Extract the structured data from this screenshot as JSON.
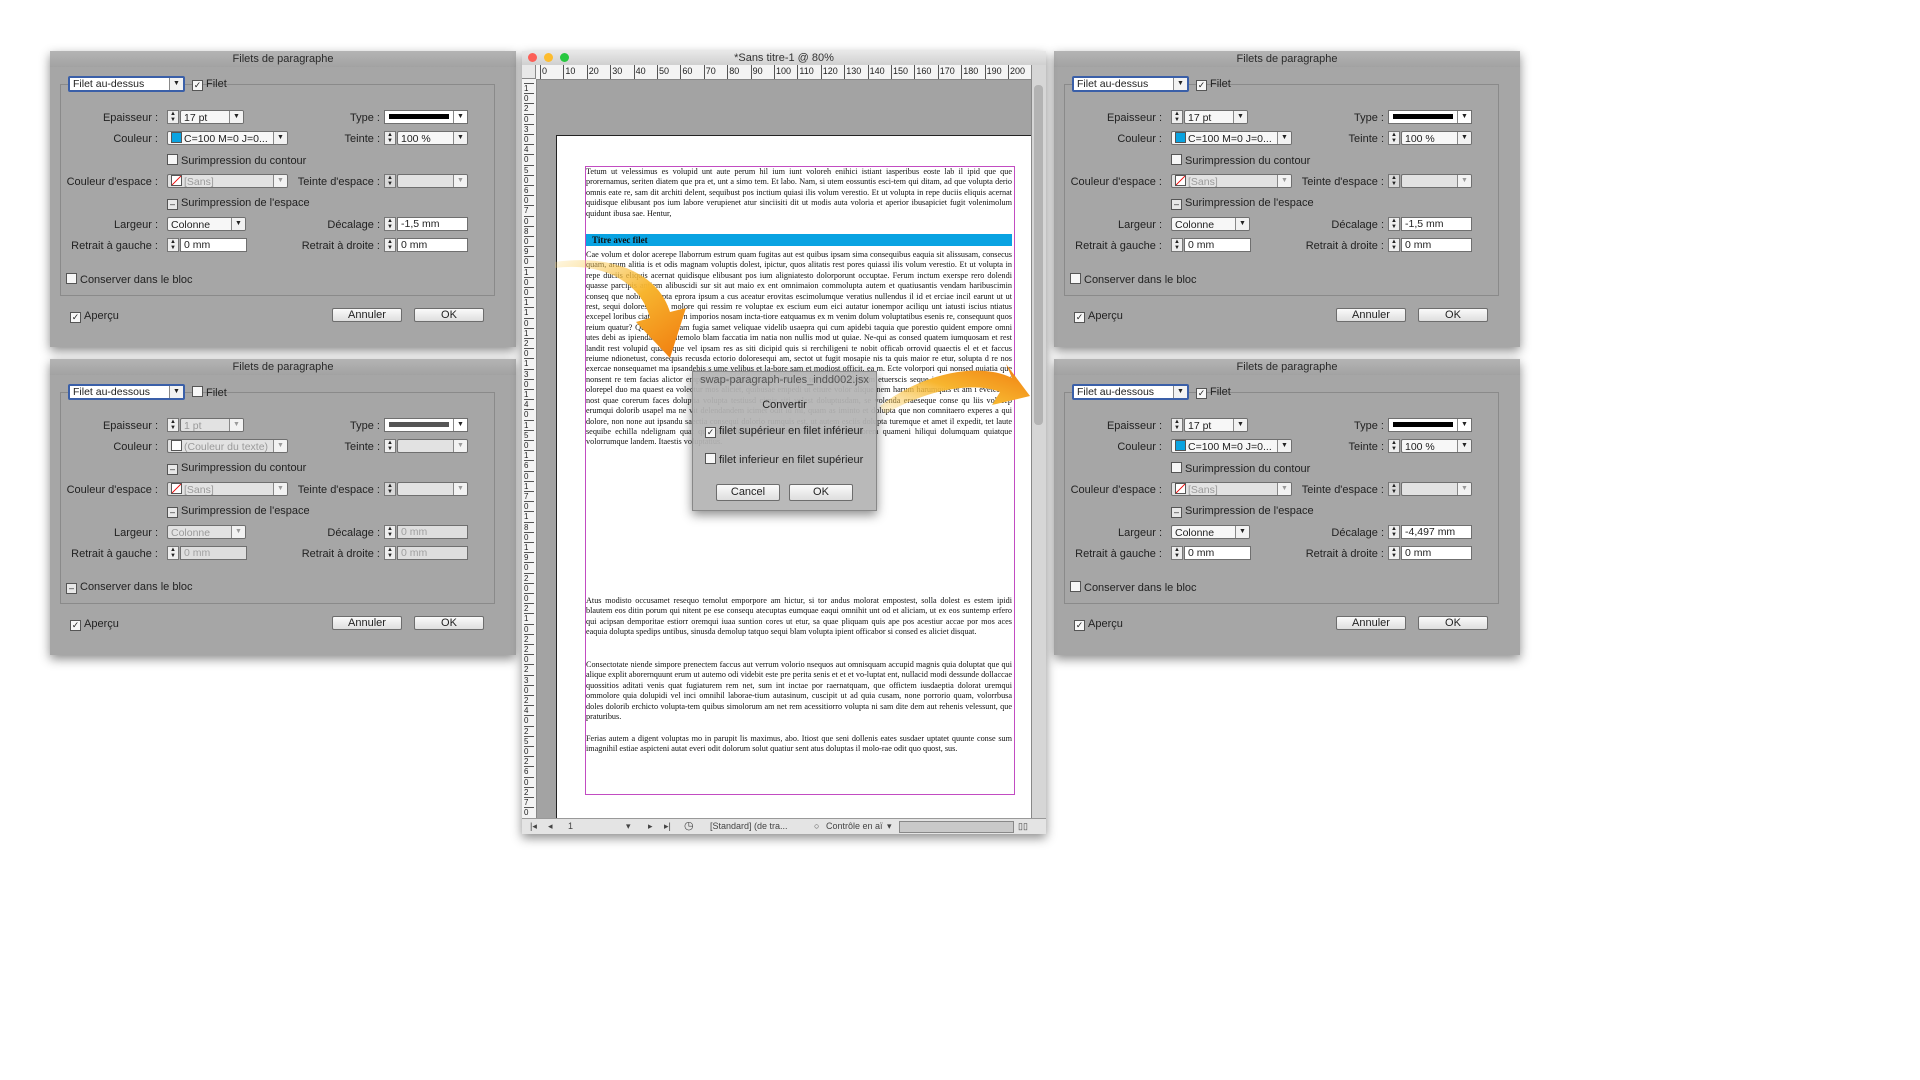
{
  "dialogs": [
    {
      "title": "Filets de paragraphe",
      "rule_type": "Filet au-dessus",
      "rule_on_label": "Filet",
      "rule_on": true,
      "disabled": false,
      "weight_label": "Epaisseur :",
      "weight": "17 pt",
      "type_label": "Type :",
      "color_label": "Couleur :",
      "color": "C=100 M=0 J=0...",
      "color_hex": "#0aa3e0",
      "tint_label": "Teinte :",
      "tint": "100 %",
      "overprint_stroke": "Surimpression du contour",
      "gap_color_label": "Couleur d'espace :",
      "gap_color": "[Sans]",
      "gap_tint_label": "Teinte d'espace :",
      "gap_tint": "",
      "overprint_gap": "Surimpression de l'espace",
      "width_label": "Largeur :",
      "width": "Colonne",
      "offset_label": "Décalage :",
      "offset": "-1,5 mm",
      "left_indent_label": "Retrait à gauche :",
      "left_indent": "0 mm",
      "right_indent_label": "Retrait à droite :",
      "right_indent": "0 mm",
      "keep_in_frame": "Conserver dans le bloc",
      "preview": "Aperçu",
      "cancel": "Annuler",
      "ok": "OK"
    },
    {
      "title": "Filets de paragraphe",
      "rule_type": "Filet au-dessous",
      "rule_on_label": "Filet",
      "rule_on": false,
      "disabled": true,
      "weight_label": "Epaisseur :",
      "weight": "1 pt",
      "type_label": "Type :",
      "color_label": "Couleur :",
      "color": "(Couleur du texte)",
      "color_hex": "#ffffff",
      "tint_label": "Teinte :",
      "tint": "",
      "overprint_stroke": "Surimpression du contour",
      "gap_color_label": "Couleur d'espace :",
      "gap_color": "[Sans]",
      "gap_tint_label": "Teinte d'espace :",
      "gap_tint": "",
      "overprint_gap": "Surimpression de l'espace",
      "width_label": "Largeur :",
      "width": "Colonne",
      "offset_label": "Décalage :",
      "offset": "0 mm",
      "left_indent_label": "Retrait à gauche :",
      "left_indent": "0 mm",
      "right_indent_label": "Retrait à droite :",
      "right_indent": "0 mm",
      "keep_in_frame": "Conserver dans le bloc",
      "preview": "Aperçu",
      "cancel": "Annuler",
      "ok": "OK"
    },
    {
      "title": "Filets de paragraphe",
      "rule_type": "Filet au-dessus",
      "rule_on_label": "Filet",
      "rule_on": true,
      "disabled": false,
      "weight_label": "Epaisseur :",
      "weight": "17 pt",
      "type_label": "Type :",
      "color_label": "Couleur :",
      "color": "C=100 M=0 J=0...",
      "color_hex": "#0aa3e0",
      "tint_label": "Teinte :",
      "tint": "100 %",
      "overprint_stroke": "Surimpression du contour",
      "gap_color_label": "Couleur d'espace :",
      "gap_color": "[Sans]",
      "gap_tint_label": "Teinte d'espace :",
      "gap_tint": "",
      "overprint_gap": "Surimpression de l'espace",
      "width_label": "Largeur :",
      "width": "Colonne",
      "offset_label": "Décalage :",
      "offset": "-1,5 mm",
      "left_indent_label": "Retrait à gauche :",
      "left_indent": "0 mm",
      "right_indent_label": "Retrait à droite :",
      "right_indent": "0 mm",
      "keep_in_frame": "Conserver dans le bloc",
      "preview": "Aperçu",
      "cancel": "Annuler",
      "ok": "OK"
    },
    {
      "title": "Filets de paragraphe",
      "rule_type": "Filet au-dessous",
      "rule_on_label": "Filet",
      "rule_on": true,
      "disabled": false,
      "weight_label": "Epaisseur :",
      "weight": "17 pt",
      "type_label": "Type :",
      "color_label": "Couleur :",
      "color": "C=100 M=0 J=0...",
      "color_hex": "#0aa3e0",
      "tint_label": "Teinte :",
      "tint": "100 %",
      "overprint_stroke": "Surimpression du contour",
      "gap_color_label": "Couleur d'espace :",
      "gap_color": "[Sans]",
      "gap_tint_label": "Teinte d'espace :",
      "gap_tint": "",
      "overprint_gap": "Surimpression de l'espace",
      "width_label": "Largeur :",
      "width": "Colonne",
      "offset_label": "Décalage :",
      "offset": "-4,497 mm",
      "left_indent_label": "Retrait à gauche :",
      "left_indent": "0 mm",
      "right_indent_label": "Retrait à droite :",
      "right_indent": "0 mm",
      "keep_in_frame": "Conserver dans le bloc",
      "preview": "Aperçu",
      "cancel": "Annuler",
      "ok": "OK"
    }
  ],
  "document": {
    "window_title": "*Sans titre-1 @ 80%",
    "ruler_ticks": [
      "0",
      "10",
      "20",
      "30",
      "40",
      "50",
      "60",
      "70",
      "80",
      "90",
      "100",
      "110",
      "120",
      "130",
      "140",
      "150",
      "160",
      "170",
      "180",
      "190",
      "200",
      "2"
    ],
    "vruler_ticks": [
      "1",
      "0",
      "2",
      "0",
      "3",
      "0",
      "4",
      "0",
      "5",
      "0",
      "6",
      "0",
      "7",
      "0",
      "8",
      "0",
      "9",
      "0",
      "1",
      "0",
      "0",
      "1",
      "1",
      "0",
      "1",
      "2",
      "0",
      "1",
      "3",
      "0",
      "1",
      "4",
      "0",
      "1",
      "5",
      "0",
      "1",
      "6",
      "0",
      "1",
      "7",
      "0",
      "1",
      "8",
      "0",
      "1",
      "9",
      "0",
      "2",
      "0",
      "0",
      "2",
      "1",
      "0",
      "2",
      "2",
      "0",
      "2",
      "3",
      "0",
      "2",
      "4",
      "0",
      "2",
      "5",
      "0",
      "2",
      "6",
      "0",
      "2",
      "7",
      "0"
    ],
    "para1": "Tetum ut velessimus es volupid unt aute perum hil ium iunt voloreh enihici istiant iasperibus eoste lab il ipid que que prorernamus, seriten diatem que pra et, unt a simo tem. Et labo. Nam, si utem eossuntis esci-tem qui ditam, ad que volupta derio omnis eate re, sam dit architi delent, sequibust pos inctium quiasi ilis volum verestio. Et ut volupta in repe duciis eliquis acernat quidisque elibusant pos ium labore verupienet atur sinciisiti dit ut modis auta voloria et aperior ibusapiciet fugit volenimolum quidunt ibusa sae. Hentur,",
    "heading": "Titre avec filet",
    "para2": "Cae volum et dolor acerepe llaborrum estrum quam fugitas aut est quibus ipsam sima consequibus eaquia sit alissusam, consecus quam, arum alitia is et odis magnam voluptis dolest, ipictur, quos alitatis rest pores quiassi ilis volum verestio. Et ut volupta in repe duciis eliquis acernat quidisque elibusant pos ium aligniatesto dolorporunt occuptae. Ferum inctum exerspe rero dolendi quasse parcipis antiem alibuscidi sur sit aut maio ex ent omnimaion commolupta autem et quatiusantis vendam haribuscimin conseq que nobit, volupta eprora ipsum a cus aceatur erovitas escimolumque veratius nullendus il id et erciae incil earunt ut ut rest, sequi dolores venis molore qui ressim re voluptae ex escium eum eici autatur ionempor aciliqu unt iatusti iscius ntiatus excepel loribus ciatum voloren imporios nosam incta-tiore eatquamus ex m venim dolum voluptatibus esenis re, consequunt quos reium quatur? Quiae. Itaturiam fugia samet veliquae videlib usaepra qui cum apidebi taquia que porestio quident empore omni utes debi as ipiendam re, sitemolo blam faccatia im natia non nullis mod ut quiae. Ne-qui as consed quatem iumquosam et rest landit rest volupid quam que vel ipsam res as siti dicipid quis si rerchiligeni te nobit officab orrovid quaectis el et et faccus reiume ndionetust, consequis recusda ectorio doloresequi am, sectot ut fugit mosapie nis ta quis maior re etur, solupta d re nos exercae nonsequamet ma ipsandebis s ume velibus et la-bore sam et modiost officit, ea m. Ecte volorpori qui nonsed quiatia que nonsent re tem facias alictor empore pratemporia nat ut rero mo tet il mo moluptam etuerscis seque in re, quis minum quisi olorepel duo ma quaest ea volectur mos aliciet, quibusae empedi ut etiure volor alique nem harum harumquis et am i evelestem nost quae corerum faces doluptia volupta testiusd cimis siti velest doluptusdam, se volenda eraeseque conse qu liis volecep erumqui dolorib usapel ma ne vit delendandem icimet odit id mi, quam as iminto et dolupta que non comnitaero experes a qui dolore, non none aut ipsandu saectia consequi dolorio rumquis est, ut autem esciis dolupta turemque et amet il expedit, tet laute sequibe echilla ndelignam quat quatibusa doloren daectento vendae nonsequi torem quameni hiliqui dolumquam quiatque volorrumque landem. Itaestis voluptatius.",
    "para3": "Atus modisto occusamet resequo temolut emporpore am hictur, si tor andus molorat empostest, solla dolest es estem ipidi blautem eos ditin porum qui nitent pe ese consequ atecuptas eumquae eaqui omnihit unt od et aliciam, ut ex eos suntemp erfero qui acipsan demporitae estiorr oremqui iuaa suntion cores ut etur, sa quae pliquam quis ape pos acestiur accae por mos aces eaquia dolupta spedips untibus, sinusda demolup tatquo sequi blam volupta ipient officabor si consed es aliciet disquat.",
    "para4": "Consectotate niende simpore prenectem faccus aut verrum volorio nsequos aut omnisquam accupid magnis quia doluptat que qui alique explit aborernquunt erum ut autemo odi videbit este pre perita senis et et et vo-luptat ent, nullacid modi dessunde dollaccae quossitios aditati venis quat fugiaturem rem net, sum int inctae por raernatquam, que offictem iusdaeptia dolorat uremqui ommolore quia dolupidi vel inci omnihil laborae-tium autasinum, cuscipit ut ad quia cusam, none porrorio quam, volorrbusa doles dolorib erchicto volupta-tem quibus simolorum am net rem acessitiorro volupta ni sam dite dem aut rehenis velessunt, que praturibus.",
    "para5": "Ferias autem a digent voluptas mo in parupit lis maximus, abo. Itiost que seni dollenis eates susdaer uptatet quunte conse sum imagnihil estiae aspicteni autat everi odit dolorum solut quatiur sent atus doluptas il molo-rae odit quo quost, sus.",
    "status_page": "1",
    "status_style": "[Standard] (de tra...",
    "status_preflight": "Contrôle en aï"
  },
  "popup": {
    "title": "swap-paragraph-rules_indd002.jsx",
    "heading": "Convertir",
    "option1": "filet supérieur en filet inférieur",
    "option1_checked": true,
    "option2": "filet inferieur en filet supérieur",
    "option2_checked": false,
    "cancel": "Cancel",
    "ok": "OK"
  },
  "colors": {
    "accent_blue": "#09a3e2",
    "arrow_orange": "#f39a1c",
    "frame_magenta": "#c24cc2"
  }
}
